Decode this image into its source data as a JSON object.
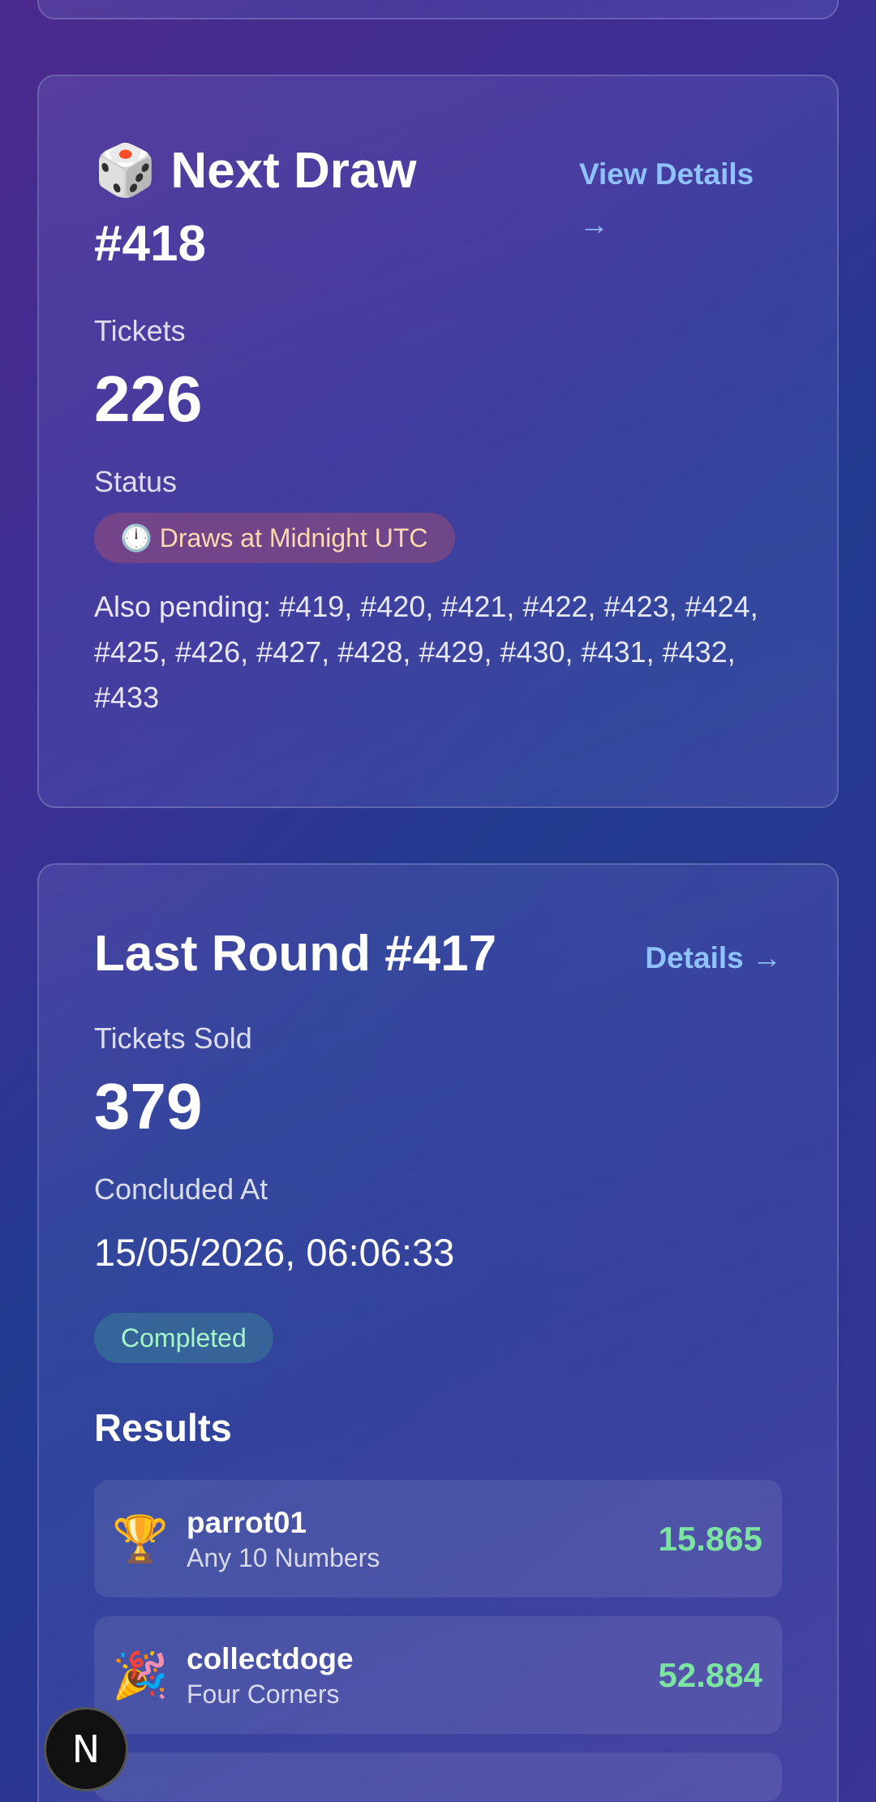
{
  "next_draw": {
    "icon": "dice-icon",
    "title_prefix": "🎲 Next Draw",
    "title_number": "#418",
    "link": "View Details →",
    "tickets_label": "Tickets",
    "tickets_value": "226",
    "status_label": "Status",
    "status_badge": "🕛 Draws at Midnight UTC",
    "pending_text": "Also pending: #419, #420, #421, #422, #423, #424, #425, #426, #427, #428, #429, #430, #431, #432, #433"
  },
  "last_round": {
    "title": "Last Round #417",
    "link": "Details →",
    "tickets_label": "Tickets Sold",
    "tickets_value": "379",
    "concluded_label": "Concluded At",
    "concluded_value": "15/05/2026, 06:06:33",
    "status_badge": "Completed",
    "results_title": "Results",
    "results": [
      {
        "icon": "🏆",
        "icon_name": "trophy-icon",
        "name": "parrot01",
        "game": "Any 10 Numbers",
        "amount": "15.865"
      },
      {
        "icon": "🎉",
        "icon_name": "party-popper-icon",
        "name": "collectdoge",
        "game": "Four Corners",
        "amount": "52.884"
      }
    ]
  },
  "floating_badge": {
    "letter": "N"
  },
  "colors": {
    "link": "#8fc2ff",
    "amount": "#7ce3a2",
    "completed_text": "#a6f5c8",
    "pending_text": "#ffd9b0"
  }
}
